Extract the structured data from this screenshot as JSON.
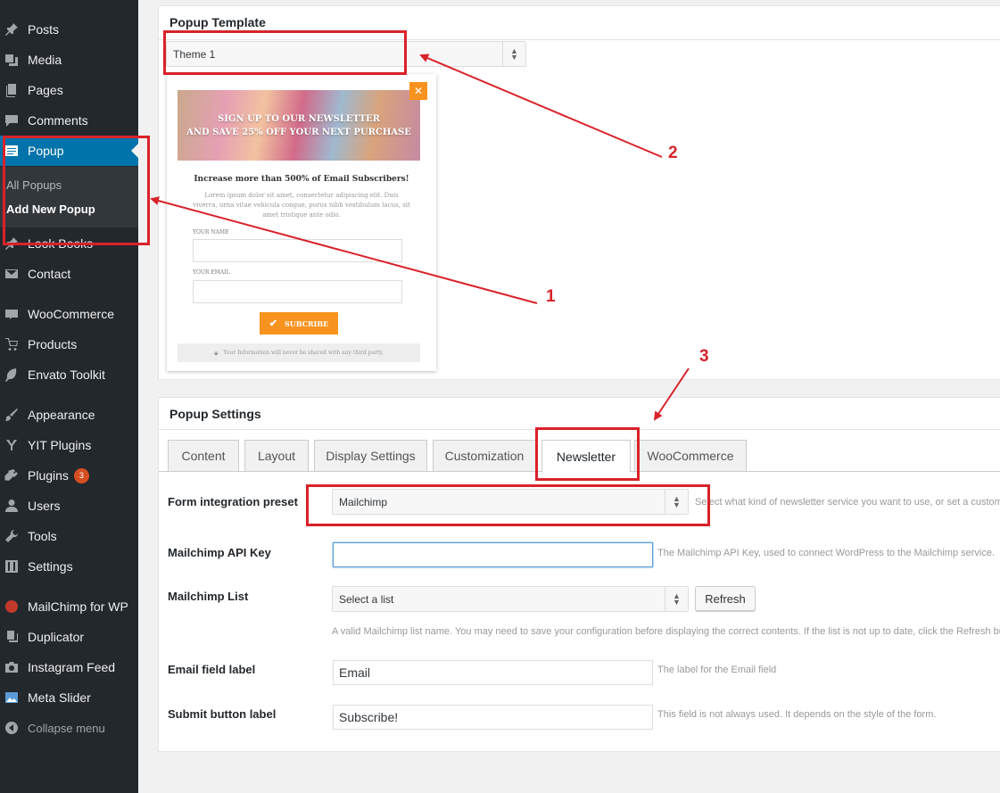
{
  "sidebar": {
    "items": [
      {
        "label": "Posts",
        "icon": "pin-icon"
      },
      {
        "label": "Media",
        "icon": "media-icon"
      },
      {
        "label": "Pages",
        "icon": "pages-icon"
      },
      {
        "label": "Comments",
        "icon": "comment-icon"
      },
      {
        "label": "Popup",
        "icon": "popup-icon"
      },
      {
        "label": "Look Books",
        "icon": "pin-icon"
      },
      {
        "label": "Contact",
        "icon": "mail-icon"
      },
      {
        "label": "WooCommerce",
        "icon": "woo-icon"
      },
      {
        "label": "Products",
        "icon": "cart-icon"
      },
      {
        "label": "Envato Toolkit",
        "icon": "leaf-icon"
      },
      {
        "label": "Appearance",
        "icon": "brush-icon"
      },
      {
        "label": "YIT Plugins",
        "icon": "yit-icon"
      },
      {
        "label": "Plugins",
        "icon": "plug-icon"
      },
      {
        "label": "Users",
        "icon": "user-icon"
      },
      {
        "label": "Tools",
        "icon": "wrench-icon"
      },
      {
        "label": "Settings",
        "icon": "settings-icon"
      },
      {
        "label": "MailChimp for WP",
        "icon": "mailchimp-icon"
      },
      {
        "label": "Duplicator",
        "icon": "duplicator-icon"
      },
      {
        "label": "Instagram Feed",
        "icon": "camera-icon"
      },
      {
        "label": "Meta Slider",
        "icon": "slider-icon"
      },
      {
        "label": "Collapse menu",
        "icon": "collapse-icon"
      }
    ],
    "submenu": [
      "All Popups",
      "Add New Popup"
    ],
    "plugins_badge": "3"
  },
  "template_panel": {
    "title": "Popup Template",
    "selected_theme": "Theme 1"
  },
  "preview": {
    "banner_line1": "SIGN UP TO OUR NEWSLETTER",
    "banner_line2": "AND SAVE 25% OFF YOUR NEXT PURCHASE",
    "heading": "Increase more than 500% of Email Subscribers!",
    "lorem": "Lorem ipsum dolor sit amet, consectetur adipiscing elit. Duis viverra, urna vitae vehicula congue, purus nibh vestibulum lacus, sit amet tristique ante odio.",
    "name_label": "YOUR NAME",
    "email_label": "YOUR EMAIL",
    "button": "SUBCRIBE",
    "footer": "Your Information will never be shared with any third party."
  },
  "settings_panel": {
    "title": "Popup Settings",
    "tabs": [
      "Content",
      "Layout",
      "Display Settings",
      "Customization",
      "Newsletter",
      "WooCommerce"
    ],
    "active_tab": "Newsletter",
    "fields": {
      "preset_label": "Form integration preset",
      "preset_value": "Mailchimp",
      "preset_desc": "Select what kind of newsletter service you want to use, or set a custom form.",
      "api_label": "Mailchimp API Key",
      "api_value": "",
      "api_desc": "The Mailchimp API Key, used to connect WordPress to the Mailchimp service.",
      "list_label": "Mailchimp List",
      "list_value": "Select a list",
      "refresh_button": "Refresh",
      "list_desc": "A valid Mailchimp list name. You may need to save your configuration before displaying the correct contents. If the list is not up to date, click the Refresh button.",
      "email_label": "Email field label",
      "email_value": "Email",
      "email_desc": "The label for the Email field",
      "submit_label": "Submit button label",
      "submit_value": "Subscribe!",
      "submit_desc": "This field is not always used. It depends on the style of the form."
    }
  },
  "annotations": [
    "1",
    "2",
    "3"
  ],
  "colors": {
    "sidebar_bg": "#23282d",
    "active_menu": "#0073aa",
    "annotation_red": "#d9222a",
    "preview_orange": "#f7931e"
  }
}
